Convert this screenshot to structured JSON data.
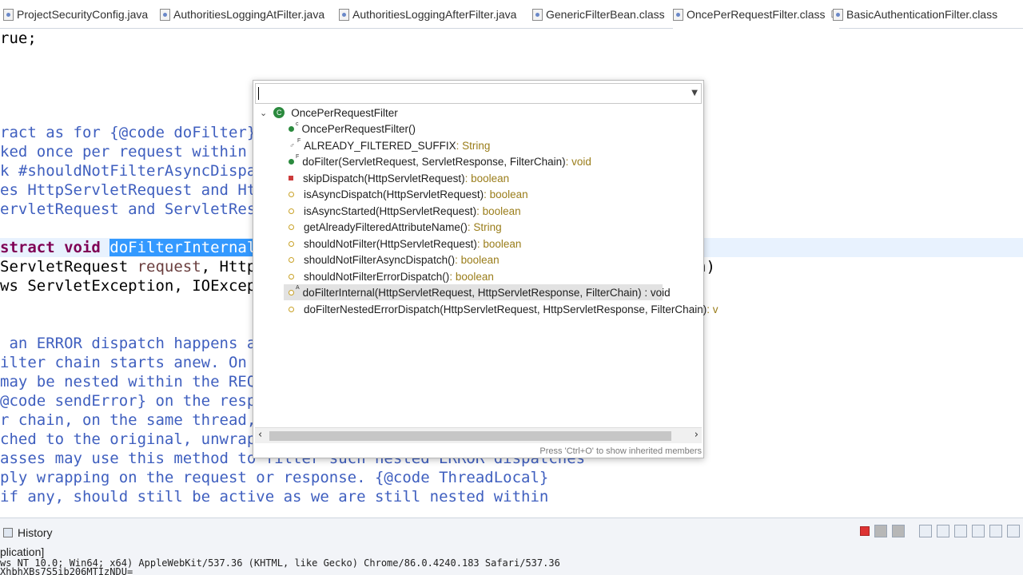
{
  "tabs": [
    {
      "label": "ProjectSecurityConfig.java"
    },
    {
      "label": "AuthoritiesLoggingAtFilter.java"
    },
    {
      "label": "AuthoritiesLoggingAfterFilter.java"
    },
    {
      "label": "GenericFilterBean.class"
    },
    {
      "label": "OncePerRequestFilter.class",
      "close": "☒"
    },
    {
      "label": "BasicAuthenticationFilter.class"
    }
  ],
  "editor": {
    "l0": "rue;",
    "c1": "ract as for {@code doFilter}",
    "c2": "ked once per request within",
    "c3": "k #shouldNotFilterAsyncDispa",
    "c4": "es HttpServletRequest and Ht",
    "c5": "ervletRequest and ServletRes",
    "d1_kw": "stract void ",
    "d1_sel": "doFilterInternal",
    "d2_a": "ServletRequest ",
    "d2_param": "request",
    "d2_b": ", Http",
    "d2_tail": "n)",
    "d3": "ws ServletException, IOExcep",
    "e1": " an ERROR dispatch happens a",
    "e2": "ilter chain starts anew. On",
    "e3": "may be nested within the REQ",
    "e4": "@code sendError} on the resp",
    "e5": "r chain, on the same thread,",
    "e6": "ched to the original, unwrap",
    "e7": "asses may use this method to filter such nested ERROR dispatches",
    "e8": "ply wrapping on the request or response. {@code ThreadLocal}",
    "e9": "if any, should still be active as we are still nested within"
  },
  "popup": {
    "filter_value": "",
    "class_name": "OncePerRequestFilter",
    "members": [
      {
        "name": "OncePerRequestFilter()",
        "type": "",
        "icon": "green",
        "sup": "c"
      },
      {
        "name": "ALREADY_FILTERED_SUFFIX",
        "type": " : String",
        "icon": "link",
        "sup": "F"
      },
      {
        "name": "doFilter(ServletRequest, ServletResponse, FilterChain)",
        "type": " : void",
        "icon": "green",
        "sup": "F"
      },
      {
        "name": "skipDispatch(HttpServletRequest)",
        "type": " : boolean",
        "icon": "red",
        "sup": ""
      },
      {
        "name": "isAsyncDispatch(HttpServletRequest)",
        "type": " : boolean",
        "icon": "yellow",
        "sup": ""
      },
      {
        "name": "isAsyncStarted(HttpServletRequest)",
        "type": " : boolean",
        "icon": "yellow",
        "sup": ""
      },
      {
        "name": "getAlreadyFilteredAttributeName()",
        "type": " : String",
        "icon": "yellow",
        "sup": ""
      },
      {
        "name": "shouldNotFilter(HttpServletRequest)",
        "type": " : boolean",
        "icon": "yellow",
        "sup": ""
      },
      {
        "name": "shouldNotFilterAsyncDispatch()",
        "type": " : boolean",
        "icon": "yellow",
        "sup": ""
      },
      {
        "name": "shouldNotFilterErrorDispatch()",
        "type": " : boolean",
        "icon": "yellow",
        "sup": ""
      },
      {
        "name": "doFilterInternal(HttpServletRequest, HttpServletResponse, FilterChain) : void",
        "type": "",
        "icon": "yellow",
        "sup": "A"
      },
      {
        "name": "doFilterNestedErrorDispatch(HttpServletRequest, HttpServletResponse, FilterChain)",
        "type": " : v",
        "icon": "yellow",
        "sup": ""
      }
    ],
    "footer": "Press 'Ctrl+O' to show inherited members"
  },
  "bottom": {
    "history_label": "History",
    "console_title": "plication]",
    "console_line1": "ws NT 10.0; Win64; x64) AppleWebKit/537.36 (KHTML, like Gecko) Chrome/86.0.4240.183 Safari/537.36",
    "console_line2": "XhbhXBs7S5ib206MTIzNDU="
  }
}
